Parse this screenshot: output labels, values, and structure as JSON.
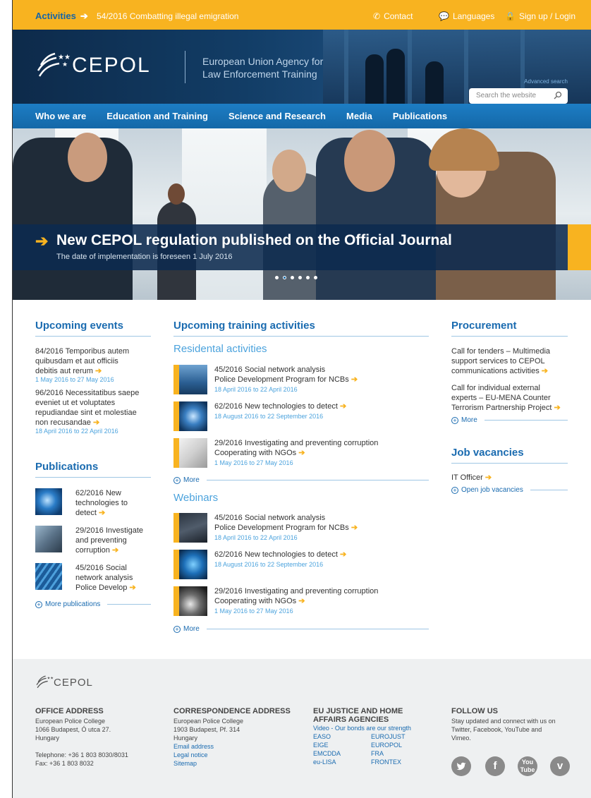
{
  "topbar": {
    "activities_label": "Activities",
    "activity_item": "54/2016 Combatting illegal emigration",
    "contact": "Contact",
    "languages": "Languages",
    "signup": "Sign up / Login"
  },
  "header": {
    "logo_text": "CEPOL",
    "tagline_line1": "European Union Agency for",
    "tagline_line2": "Law Enforcement Training",
    "search_placeholder": "Search the website",
    "advanced_search": "Advanced search"
  },
  "nav": {
    "items": [
      "Who we are",
      "Education and Training",
      "Science and Research",
      "Media",
      "Publications"
    ]
  },
  "hero": {
    "title": "New CEPOL regulation published on the Official Journal",
    "subtitle": "The date of implementation is foreseen 1 July 2016",
    "slides": 6,
    "active_slide": 1
  },
  "upcoming_events": {
    "title": "Upcoming events",
    "items": [
      {
        "text": "84/2016 Temporibus autem quibusdam et aut officiis debitis aut rerum",
        "date": "1 May 2016 to 27 May 2016"
      },
      {
        "text": "96/2016 Necessitatibus saepe eveniet ut et voluptates repudiandae sint et molestiae non recusandae",
        "date": "18 April 2016 to 22 April 2016"
      }
    ]
  },
  "publications": {
    "title": "Publications",
    "items": [
      {
        "line1": "62/2016 New",
        "line2": "technologies to",
        "line3": "detect"
      },
      {
        "line1": "29/2016 Investigate",
        "line2": "and preventing",
        "line3": "corruption"
      },
      {
        "line1": "45/2016 Social",
        "line2": "network analysis",
        "line3": "Police Develop"
      }
    ],
    "more": "More publications"
  },
  "training": {
    "title": "Upcoming training activities",
    "residential_title": "Residental activities",
    "residential": [
      {
        "line1": "45/2016 Social network analysis",
        "line2": "Police Development Program for NCBs",
        "date": "18 April 2016 to 22 April 2016"
      },
      {
        "line1": "62/2016 New technologies to detect",
        "line2": "",
        "date": "18 August 2016 to 22 September 2016"
      },
      {
        "line1": "29/2016 Investigating and preventing corruption",
        "line2": "Cooperating with NGOs",
        "date": "1 May 2016 to 27 May 2016"
      }
    ],
    "webinars_title": "Webinars",
    "webinars": [
      {
        "line1": "45/2016 Social network analysis",
        "line2": "Police Development Program for NCBs",
        "date": "18 April 2016 to 22 April 2016"
      },
      {
        "line1": "62/2016 New technologies to detect",
        "line2": "",
        "date": "18 August 2016 to 22 September 2016"
      },
      {
        "line1": "29/2016 Investigating and preventing corruption",
        "line2": "Cooperating with NGOs",
        "date": "1 May 2016 to 27 May 2016"
      }
    ],
    "more": "More"
  },
  "procurement": {
    "title": "Procurement",
    "items": [
      {
        "l1": "Call for tenders – Multimedia",
        "l2": "support services to CEPOL",
        "l3": "communications activities"
      },
      {
        "l1": "Call for individual external",
        "l2": "experts – EU-MENA Counter",
        "l3": "Terrorism Partnership Project"
      }
    ],
    "more": "More"
  },
  "jobs": {
    "title": "Job vacancies",
    "item": "IT Officer",
    "more": "Open job vacancies"
  },
  "footer": {
    "logo_text": "CEPOL",
    "office": {
      "title": "OFFICE ADDRESS",
      "l1": "European Police College",
      "l2": "1066 Budapest, Ó utca 27.",
      "l3": "Hungary",
      "tel": "Telephone: +36 1 803 8030/8031",
      "fax": "Fax: +36 1 803 8032"
    },
    "corr": {
      "title": "CORRESPONDENCE ADDRESS",
      "l1": "European Police College",
      "l2": "1903 Budapest, Pf. 314",
      "l3": "Hungary",
      "email": "Email address",
      "legal": "Legal notice",
      "sitemap": "Sitemap"
    },
    "agencies": {
      "title1": "EU JUSTICE AND HOME",
      "title2": "AFFAIRS AGENCIES",
      "video": "Video - Our bonds are our strength",
      "left": [
        "EASO",
        "EIGE",
        "EMCDDA",
        "eu-LISA"
      ],
      "right": [
        "EUROJUST",
        "EUROPOL",
        "FRA",
        "FRONTEX"
      ]
    },
    "follow": {
      "title": "FOLLOW US",
      "l1": "Stay updated and connect with us on",
      "l2": "Twitter, Facebook, YouTube and",
      "l3": "Vimeo.",
      "icons": [
        "twitter-icon",
        "facebook-icon",
        "youtube-icon",
        "vimeo-icon"
      ]
    }
  },
  "colors": {
    "orange": "#f8b320",
    "blue": "#1a6bb0",
    "navy": "#0d2a4a",
    "light_blue": "#4ca3dd"
  }
}
